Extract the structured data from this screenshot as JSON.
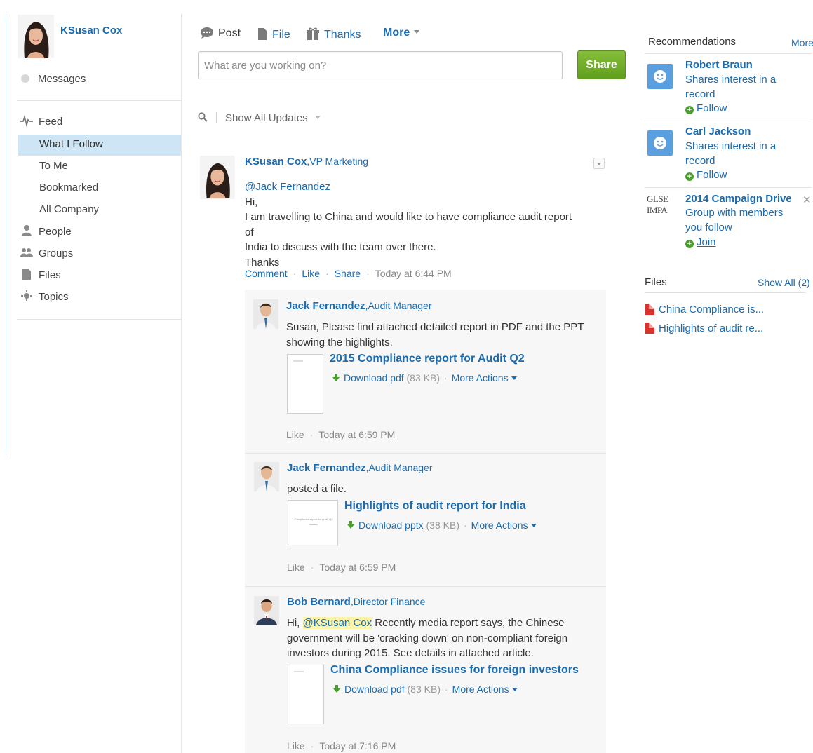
{
  "user": {
    "name": "KSusan Cox"
  },
  "sidebar": {
    "messages_label": "Messages",
    "feed_label": "Feed",
    "feed_items": [
      {
        "label": "What I Follow"
      },
      {
        "label": "To Me"
      },
      {
        "label": "Bookmarked"
      },
      {
        "label": "All Company"
      }
    ],
    "people_label": "People",
    "groups_label": "Groups",
    "files_label": "Files",
    "topics_label": "Topics"
  },
  "publisher": {
    "tabs": {
      "post": "Post",
      "file": "File",
      "thanks": "Thanks",
      "more": "More"
    },
    "placeholder": "What are you working on?",
    "share_label": "Share"
  },
  "filter": {
    "show_label": "Show",
    "value": "All Updates"
  },
  "post": {
    "author": "KSusan Cox",
    "title": ",VP Marketing",
    "mention": "@Jack Fernandez",
    "lines": [
      "Hi,",
      "I am travelling to China and would like to have compliance audit report of",
      "India to discuss with the team over there.",
      "Thanks"
    ],
    "actions": {
      "comment": "Comment",
      "like": "Like",
      "share": "Share",
      "time": "Today at 6:44 PM"
    }
  },
  "comments": [
    {
      "author": "Jack Fernandez",
      "title": ",Audit Manager",
      "lines": [
        "Susan, Please find attached detailed report in PDF and the PPT",
        "showing the highlights."
      ],
      "file": {
        "title": "2015 Compliance report for Audit Q2",
        "download": "Download pdf",
        "size": "(83 KB)",
        "more": "More Actions"
      },
      "like": "Like",
      "time": "Today at 6:59 PM"
    },
    {
      "author": "Jack Fernandez",
      "title": ",Audit Manager",
      "lines": [
        "posted a file."
      ],
      "file": {
        "title": "Highlights of audit report for India",
        "download": "Download pptx",
        "size": "(38 KB)",
        "more": "More Actions",
        "thumb_text": "Compliance report for Audit Q2"
      },
      "like": "Like",
      "time": "Today at 6:59 PM"
    },
    {
      "author": "Bob Bernard",
      "title": ",Director Finance",
      "pre": "Hi,",
      "mention": "@KSusan Cox",
      "lines": [
        " Recently media report says, the Chinese",
        "government will be 'cracking down' on non-compliant foreign",
        "investors during 2015. See details in attached article."
      ],
      "file": {
        "title": "China Compliance issues for foreign investors",
        "download": "Download pdf",
        "size": "(83 KB)",
        "more": "More Actions"
      },
      "like": "Like",
      "time": "Today at 7:16 PM"
    }
  ],
  "recommendations": {
    "heading": "Recommendations",
    "more_label": "More",
    "items": [
      {
        "name": "Robert Braun",
        "desc": "Shares interest in a record",
        "action": "Follow"
      },
      {
        "name": "Carl Jackson",
        "desc": "Shares interest in a record",
        "action": "Follow"
      },
      {
        "name": "2014 Campaign Drive",
        "desc": "Group with members you follow",
        "action": "Join",
        "logo_text": [
          "GLSE",
          "IMPA"
        ]
      }
    ]
  },
  "files_panel": {
    "heading": "Files",
    "show_all": "Show All (2)",
    "items": [
      {
        "label": "China Compliance is..."
      },
      {
        "label": "Highlights of audit re..."
      }
    ]
  },
  "colors": {
    "link": "#1a6bb0",
    "share_button": "#6aa829",
    "active_nav": "#cde5f5",
    "mention_highlight": "#fbf3a8"
  }
}
